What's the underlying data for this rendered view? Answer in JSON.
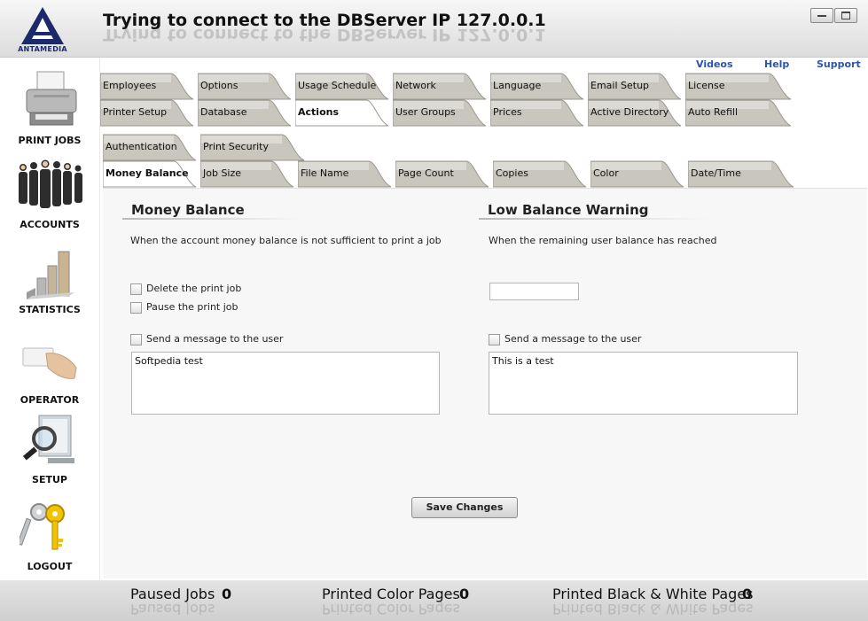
{
  "app": {
    "logo_text": "ANTAMEDIA",
    "title": "Trying to connect to the DBServer IP 127.0.0.1"
  },
  "window_buttons": {
    "minimize": "minimize-icon",
    "maximize": "maximize-icon"
  },
  "top_links": {
    "videos": "Videos",
    "help": "Help",
    "support": "Support"
  },
  "sidebar": {
    "items": [
      {
        "label": "PRINT JOBS",
        "icon": "printer-icon"
      },
      {
        "label": "ACCOUNTS",
        "icon": "people-icon"
      },
      {
        "label": "STATISTICS",
        "icon": "bar-chart-icon"
      },
      {
        "label": "OPERATOR",
        "icon": "card-hand-icon"
      },
      {
        "label": "SETUP",
        "icon": "magnifier-icon"
      },
      {
        "label": "LOGOUT",
        "icon": "keys-icon"
      }
    ]
  },
  "tabs_row1": [
    "Employees",
    "Options",
    "Usage Schedule",
    "Network",
    "Language",
    "Email Setup",
    "License"
  ],
  "tabs_row2": [
    "Printer Setup",
    "Database",
    "Actions",
    "User Groups",
    "Prices",
    "Active Directory",
    "Auto Refill"
  ],
  "subtabs_row1": [
    "Authentication",
    "Print Security"
  ],
  "subtabs_row2": [
    "Money Balance",
    "Job Size",
    "File Name",
    "Page Count",
    "Copies",
    "Color",
    "Date/Time"
  ],
  "active_tab": "Actions",
  "active_subtab": "Money Balance",
  "money_balance": {
    "title": "Money Balance",
    "description": "When the account money balance is not sufficient to print a job",
    "delete_label": "Delete the print job",
    "delete_checked": false,
    "pause_label": "Pause the print job",
    "pause_checked": false,
    "send_label": "Send a message to the user",
    "send_checked": false,
    "message": "Softpedia test"
  },
  "low_balance": {
    "title": "Low Balance Warning",
    "description": "When the remaining user balance has reached",
    "threshold": "",
    "send_label": "Send a message to the user",
    "send_checked": false,
    "message": "This is a test"
  },
  "save_label": "Save Changes",
  "status": {
    "paused_label": "Paused Jobs",
    "paused_value": "0",
    "color_label": "Printed Color Pages",
    "color_value": "0",
    "bw_label": "Printed Black & White Pages",
    "bw_value": "0"
  }
}
